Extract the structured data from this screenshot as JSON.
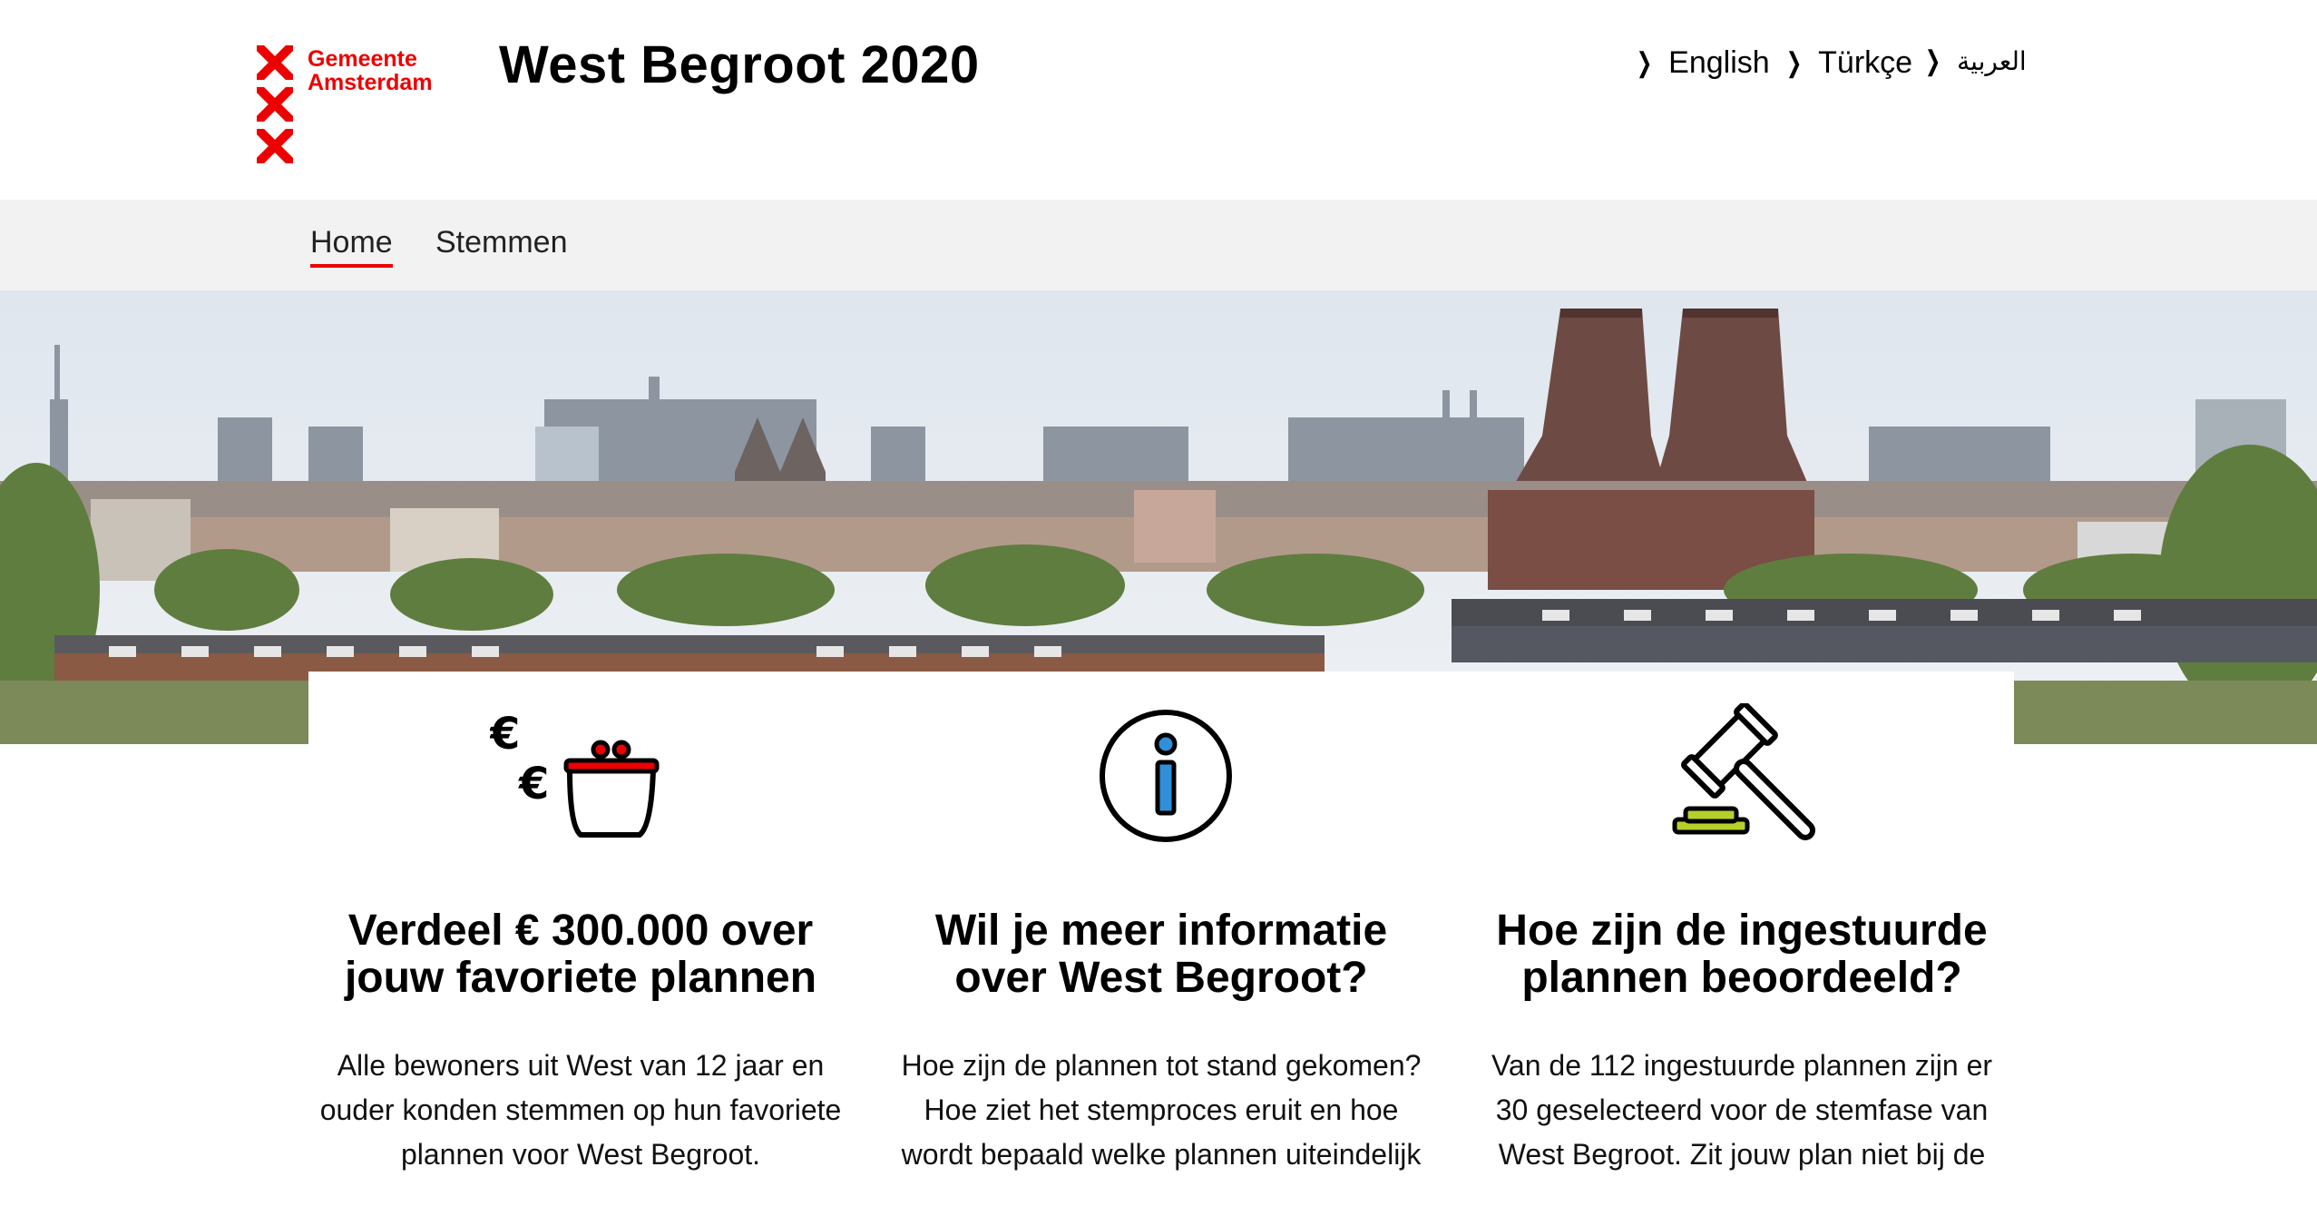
{
  "logo": {
    "line1": "Gemeente",
    "line2": "Amsterdam",
    "brand_color": "#ec0000"
  },
  "site_title": "West Begroot 2020",
  "languages": [
    "English",
    "Türkçe",
    "العربية"
  ],
  "nav": {
    "items": [
      "Home",
      "Stemmen"
    ],
    "active": "Home"
  },
  "hero": {
    "image": "amsterdam-skyline-photo"
  },
  "cards": [
    {
      "icon": "wallet-euro-icon",
      "title_line1": "Verdeel € 300.000 over",
      "title_line2": "jouw favoriete plannen",
      "text_line1": "Alle bewoners uit West van 12 jaar en",
      "text_line2": "ouder konden stemmen op hun favoriete",
      "text_line3": "plannen voor West Begroot."
    },
    {
      "icon": "info-icon",
      "title_line1": "Wil je meer informatie",
      "title_line2": "over West Begroot?",
      "text_line1": "Hoe zijn de plannen tot stand gekomen?",
      "text_line2": "Hoe ziet het stemproces eruit en hoe",
      "text_line3": "wordt bepaald welke plannen uiteindelijk"
    },
    {
      "icon": "gavel-icon",
      "title_line1": "Hoe zijn de ingestuurde",
      "title_line2": "plannen beoordeeld?",
      "text_line1": "Van de 112 ingestuurde plannen zijn er",
      "text_line2": "30 geselecteerd voor de stemfase van",
      "text_line3": "West Begroot. Zit jouw plan niet bij de"
    }
  ]
}
